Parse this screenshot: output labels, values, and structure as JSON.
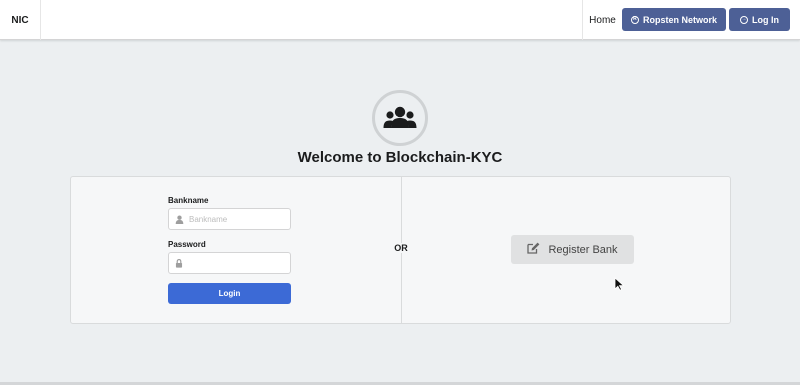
{
  "nav": {
    "brand": "NIC",
    "home": "Home",
    "network_button": "Ropsten Network",
    "login_button": "Log In"
  },
  "header": {
    "title": "Welcome to Blockchain-KYC",
    "icon": "users-icon"
  },
  "login_form": {
    "bankname_label": "Bankname",
    "bankname_placeholder": "Bankname",
    "bankname_value": "",
    "password_label": "Password",
    "password_value": "",
    "submit_label": "Login"
  },
  "divider": "OR",
  "register": {
    "label": "Register Bank",
    "icon": "edit-icon"
  },
  "colors": {
    "nav_button": "#4d6096",
    "login_button": "#3c6ad6",
    "register_button": "#e0e1e2",
    "background": "#eceff1"
  }
}
